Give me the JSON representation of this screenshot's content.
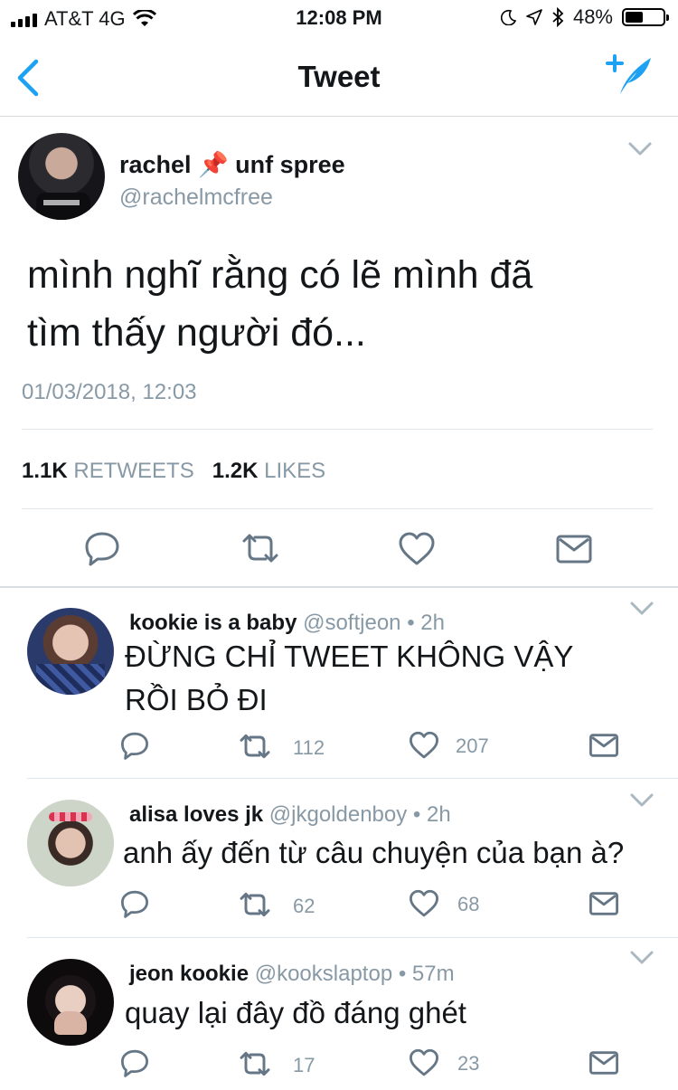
{
  "status_bar": {
    "carrier": "AT&T 4G",
    "time": "12:08 PM",
    "battery": "48%",
    "battery_level": 0.48
  },
  "nav": {
    "title": "Tweet",
    "back_icon": "chevron-left-icon",
    "compose_icon": "compose-tweet-icon"
  },
  "tweet": {
    "name": "rachel 📌 unf spree",
    "handle": "@rachelmcfree",
    "text_line1": "mình nghĩ rằng có lẽ mình đã",
    "text_line2": "tìm thấy người đó...",
    "timestamp": "01/03/2018, 12:03",
    "retweets_count": "1.1K",
    "retweets_label": "RETWEETS",
    "likes_count": "1.2K",
    "likes_label": "LIKES"
  },
  "replies": [
    {
      "name": "kookie is a baby",
      "handle": "@softjeon",
      "time": "• 2h",
      "text_line1": "ĐỪNG CHỈ TWEET KHÔNG VẬY",
      "text_line2": "RỒI BỎ ĐI",
      "retweets": "112",
      "likes": "207"
    },
    {
      "name": "alisa loves jk",
      "handle": "@jkgoldenboy",
      "time": "• 2h",
      "text_line1": "anh ấy đến từ câu chuyện của bạn à?",
      "retweets": "62",
      "likes": "68"
    },
    {
      "name": "jeon kookie",
      "handle": "@kookslaptop",
      "time": "• 57m",
      "text_line1": "quay lại đây đồ đáng ghét",
      "retweets": "17",
      "likes": "23"
    }
  ],
  "colors": {
    "accent": "#1da1f2",
    "muted": "#8899a6",
    "text": "#14171a",
    "divider": "#e1e8ed"
  }
}
